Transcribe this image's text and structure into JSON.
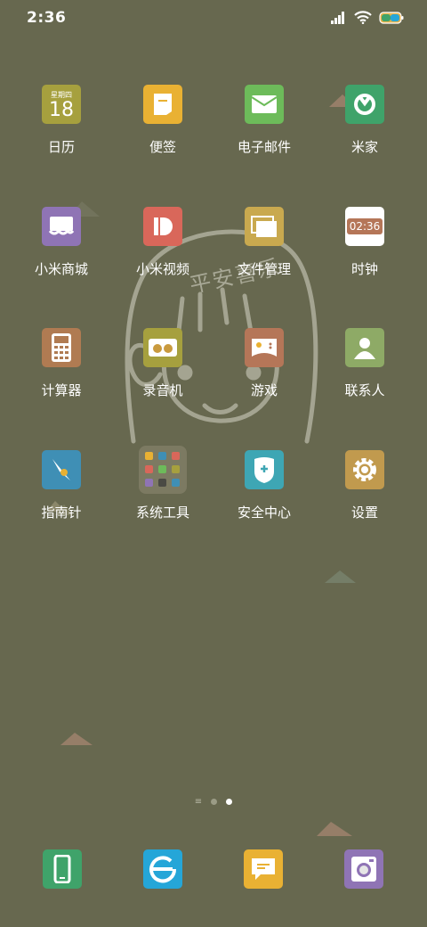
{
  "status_bar": {
    "time": "2:36",
    "icons": [
      "signal-icon",
      "wifi-icon",
      "battery-icon"
    ]
  },
  "wallpaper": {
    "watermark_text": "平安喜乐"
  },
  "calendar_tile": {
    "weekday": "星期四",
    "day": "18"
  },
  "clock_tile": {
    "time": "02:36"
  },
  "apps": [
    {
      "label": "日历",
      "icon": "calendar-icon",
      "color": "#a6a03e"
    },
    {
      "label": "便签",
      "icon": "notes-icon",
      "color": "#e9b133"
    },
    {
      "label": "电子邮件",
      "icon": "mail-icon",
      "color": "#6dbb5a"
    },
    {
      "label": "米家",
      "icon": "mijia-icon",
      "color": "#3fa36a"
    },
    {
      "label": "小米商城",
      "icon": "store-icon",
      "color": "#8f74b5"
    },
    {
      "label": "小米视频",
      "icon": "video-icon",
      "color": "#d9675a"
    },
    {
      "label": "文件管理",
      "icon": "folder-icon",
      "color": "#c9a94f"
    },
    {
      "label": "时钟",
      "icon": "clock-icon",
      "color": "#ffffff"
    },
    {
      "label": "计算器",
      "icon": "calculator-icon",
      "color": "#b07b52"
    },
    {
      "label": "录音机",
      "icon": "recorder-icon",
      "color": "#a6a03e"
    },
    {
      "label": "游戏",
      "icon": "game-icon",
      "color": "#b57658"
    },
    {
      "label": "联系人",
      "icon": "contacts-icon",
      "color": "#8eaa66"
    },
    {
      "label": "指南针",
      "icon": "compass-icon",
      "color": "#3f8fb5"
    },
    {
      "label": "系统工具",
      "icon": "folder-grid-icon",
      "color": "#7c7a62"
    },
    {
      "label": "安全中心",
      "icon": "security-icon",
      "color": "#3ea6b4"
    },
    {
      "label": "设置",
      "icon": "settings-icon",
      "color": "#c19a4e"
    }
  ],
  "dock": [
    {
      "icon": "phone-icon",
      "color": "#3fa36a"
    },
    {
      "icon": "browser-icon",
      "color": "#25a6d8"
    },
    {
      "icon": "messages-icon",
      "color": "#e9b133"
    },
    {
      "icon": "camera-icon",
      "color": "#8f74b5"
    }
  ],
  "page_indicator": {
    "pages": 2,
    "current": 2
  }
}
